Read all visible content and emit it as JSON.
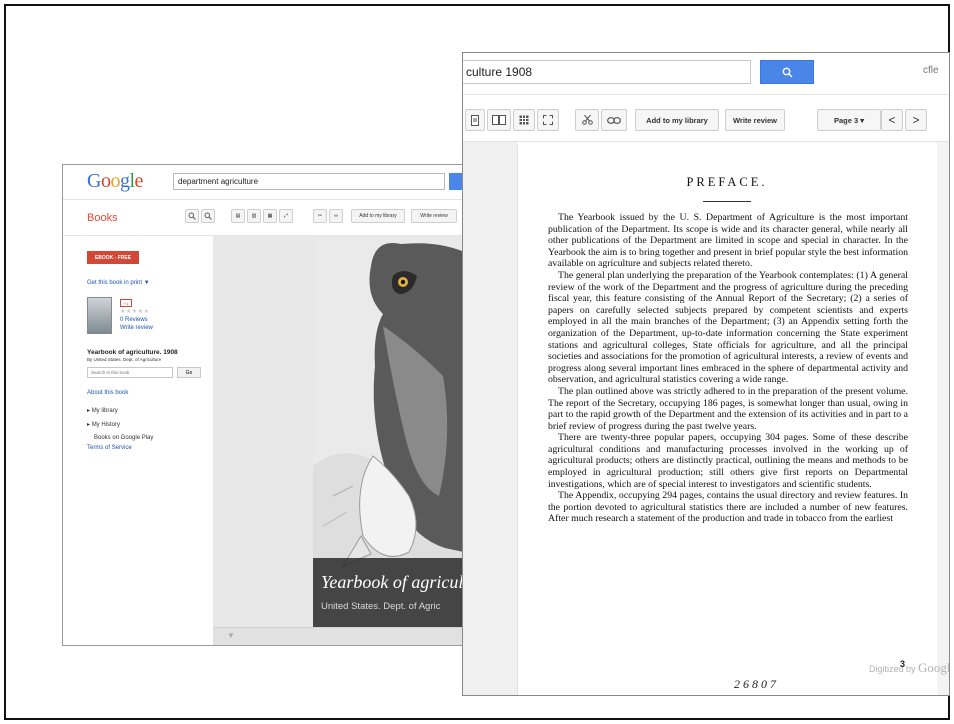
{
  "back_window": {
    "logo": "Google",
    "search_value": "department agriculture",
    "section": "Books",
    "toolbar": {
      "add_library": "Add to my library",
      "write_review": "Write review"
    },
    "ebook_label": "EBOOK - FREE",
    "get_print": "Get this book in print ▼",
    "gplus": "+1",
    "reviews": "0 Reviews",
    "write_review": "Write review",
    "book_title": "Yearbook of agriculture. 1908",
    "book_author": "By United States. Dept. of Agriculture",
    "search_in_book_placeholder": "Search in this book",
    "go_label": "Go",
    "about": "About this book",
    "my_library": "My library",
    "my_history": "My History",
    "books_on_play": "Books on Google Play",
    "terms": "Terms of Service",
    "cover_title": "Yearbook of agricul",
    "cover_author": "United States. Dept. of Agric"
  },
  "front_window": {
    "search_value": "culture 1908",
    "user": "cfle",
    "toolbar": {
      "add_library": "Add to my library",
      "write_review": "Write review",
      "page_select": "Page 3 ▾",
      "prev": "<",
      "next": ">"
    },
    "page": {
      "heading": "PREFACE.",
      "paragraphs": [
        "The Yearbook issued by the U. S. Department of Agriculture is the most important publication of the Department. Its scope is wide and its character general, while nearly all other publications of the Department are limited in scope and special in character. In the Yearbook the aim is to bring together and present in brief popular style the best information available on agriculture and subjects related thereto.",
        "The general plan underlying the preparation of the Yearbook contemplates: (1) A general review of the work of the Department and the progress of agriculture during the preceding fiscal year, this feature consisting of the Annual Report of the Secretary; (2) a series of papers on carefully selected subjects prepared by competent scientists and experts employed in all the main branches of the Department; (3) an Appendix setting forth the organization of the Department, up-to-date information concerning the State experiment stations and agricultural colleges, State officials for agriculture, and all the principal societies and associations for the promotion of agricultural interests, a review of events and progress along several important lines embraced in the sphere of departmental activity and observation, and agricultural statistics covering a wide range.",
        "The plan outlined above was strictly adhered to in the preparation of the present volume. The report of the Secretary, occupying 186 pages, is somewhat longer than usual, owing in part to the rapid growth of the Department and the extension of its activities and in part to a brief review of progress during the past twelve years.",
        "There are twenty-three popular papers, occupying 304 pages. Some of these describe agricultural conditions and manufacturing processes involved in the working up of agricultural products; others are distinctly practical, outlining the means and methods to be employed in agricultural production; still others give first reports on Departmental investigations, which are of special interest to investigators and scientific students.",
        "The Appendix, occupying 294 pages, contains the usual directory and review features. In the portion devoted to agricultural statistics there are included a number of new features. After much research a statement of the production and trade in tobacco from the earliest"
      ],
      "handwritten": "26807",
      "watermark_text": "Digitized by",
      "watermark_brand": "Google",
      "page_number": "3"
    }
  }
}
